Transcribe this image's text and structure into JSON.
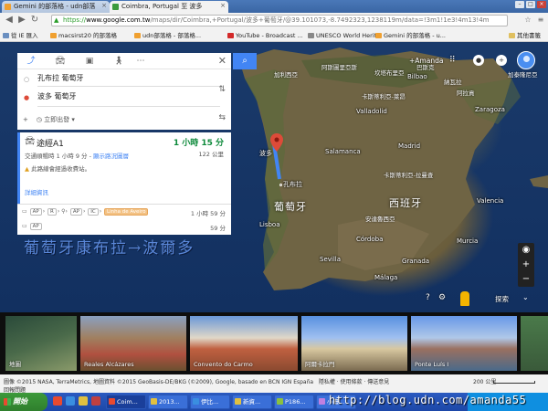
{
  "browser": {
    "tabs": [
      {
        "label": "Gemini 的部落格 - udn部落",
        "active": false
      },
      {
        "label": "Coimbra, Portugal 至 波多",
        "active": true
      }
    ],
    "url_scheme": "https://",
    "url_host": "www.google.com.tw",
    "url_path": "/maps/dir/Coimbra,+Portugal/波多+葡萄牙/@39.101073,-8.7492323,1238119m/data=!3m1!1e3!4m13!4m",
    "bookmarks": [
      "從 IE 匯入",
      "macsirst20 的部落格",
      "udn部落格 - 部落格...",
      "YouTube - Broadcast ...",
      "UNESCO World Herit...",
      "Gemini 的部落格 - u...",
      "其他書籤"
    ]
  },
  "directions": {
    "origin": "孔布拉 葡萄牙",
    "destination": "波多 葡萄牙",
    "add_label": "+",
    "depart_label": "立即出發",
    "route": {
      "title": "途經A1",
      "duration": "1 小時 15 分",
      "distance": "122 公里",
      "sub_prefix": "交通順暢時 1 小時 9 分",
      "sub_link": "顯示路況圖層",
      "warning": "此路線會經過收費站。",
      "details": "詳細資訊"
    },
    "alternatives": [
      {
        "chips": [
          "AP",
          "R",
          "AP",
          "IC"
        ],
        "highlight": "Linha de Aveiro",
        "time": "1 小時 59 分"
      },
      {
        "chips": [
          "AP"
        ],
        "highlight": "",
        "time": "59 分"
      }
    ]
  },
  "map": {
    "account_label": "+Amanda",
    "countries": [
      "葡萄牙",
      "西班牙"
    ],
    "sea_label": "地圖",
    "cities": [
      "波多",
      "孔布拉",
      "Lisboa",
      "Bilbao",
      "Zaragoza",
      "Madrid",
      "Valladolid",
      "Sevilla",
      "Granada",
      "Murcia",
      "Valencia",
      "Salamanca",
      "Córdoba",
      "Málaga"
    ],
    "regions": [
      "卡斯蒂利亞-萊昂",
      "阿拉貢",
      "加泰隆尼亞",
      "卡斯蒂利亞-拉曼查",
      "安達魯西亞",
      "巴斯克",
      "加利西亞",
      "納瓦拉",
      "阿斯圖里亞斯",
      "坎塔布里亞"
    ],
    "watermark": "葡萄牙康布拉→波爾多",
    "explore_label": "探索"
  },
  "photos": [
    {
      "caption": "地圖"
    },
    {
      "caption": "Reales Alcázares"
    },
    {
      "caption": "Convento do Carmo"
    },
    {
      "caption": "阿爾卡拉門"
    },
    {
      "caption": "Ponte Luís I"
    },
    {
      "caption": ""
    }
  ],
  "footer": {
    "copyright": "圖像 ©2015 NASA, TerraMetrics, 地圖資料 ©2015 GeoBasis-DE/BKG (©2009), Google, basado en BCN IGN España",
    "links": "隱私權 · 使用條款 · 傳送意見",
    "copyright2": "回報問題",
    "scale": "200 公里"
  },
  "taskbar": {
    "start": "開始",
    "tasks": [
      "Coim...",
      "2013...",
      "伊比...",
      "新資...",
      "P186...",
      "小畫..."
    ],
    "blog_url": "http://blog.udn.com/amanda55"
  },
  "colors": {
    "accent": "#4285f4",
    "route_time": "#0e8a3b",
    "taskbar": "#1d48a8"
  }
}
